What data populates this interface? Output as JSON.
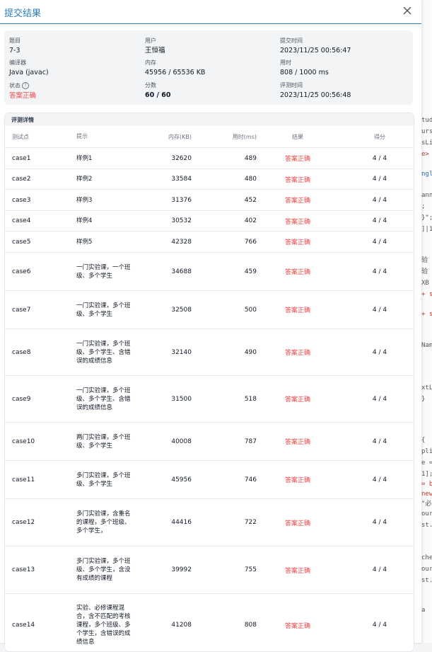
{
  "modal": {
    "title": "提交结果"
  },
  "info": {
    "problem_label": "题目",
    "problem_value": "7-3",
    "user_label": "用户",
    "user_value": "王恒福",
    "submit_time_label": "提交时间",
    "submit_time_value": "2023/11/25 00:56:47",
    "compiler_label": "编译器",
    "compiler_value": "Java (javac)",
    "memory_label": "内存",
    "memory_value": "45956 / 65536 KB",
    "time_label": "用时",
    "time_value": "808 / 1000 ms",
    "status_label": "状态",
    "status_help": "?",
    "status_value": "答案正确",
    "score_label": "分数",
    "score_value": "60 / 60",
    "judge_time_label": "评测时间",
    "judge_time_value": "2023/11/25 00:56:48"
  },
  "detail": {
    "title": "评测详情",
    "headers": {
      "case": "测试点",
      "hint": "提示",
      "memory": "内存(KB)",
      "time": "用时(ms)",
      "result": "结果",
      "score": "得分"
    },
    "rows": [
      {
        "case": "case1",
        "hint": "样例1",
        "memory": "32620",
        "time": "489",
        "result": "答案正确",
        "score": "4 / 4"
      },
      {
        "case": "case2",
        "hint": "样例2",
        "memory": "33584",
        "time": "480",
        "result": "答案正确",
        "score": "4 / 4"
      },
      {
        "case": "case3",
        "hint": "样例3",
        "memory": "31376",
        "time": "452",
        "result": "答案正确",
        "score": "4 / 4"
      },
      {
        "case": "case4",
        "hint": "样例4",
        "memory": "30532",
        "time": "402",
        "result": "答案正确",
        "score": "4 / 4"
      },
      {
        "case": "case5",
        "hint": "样例5",
        "memory": "42328",
        "time": "766",
        "result": "答案正确",
        "score": "4 / 4"
      },
      {
        "case": "case6",
        "hint": "一门实验课，一个班级、多个学生",
        "memory": "34688",
        "time": "459",
        "result": "答案正确",
        "score": "4 / 4"
      },
      {
        "case": "case7",
        "hint": "一门实验课，多个班级、多个学生",
        "memory": "32508",
        "time": "500",
        "result": "答案正确",
        "score": "4 / 4"
      },
      {
        "case": "case8",
        "hint": "一门实验课，多个班级、多个学生、含错误的成绩信息",
        "memory": "32140",
        "time": "490",
        "result": "答案正确",
        "score": "4 / 4"
      },
      {
        "case": "case9",
        "hint": "一门实验课，多个班级、多个学生、含错误的成绩信息",
        "memory": "31500",
        "time": "518",
        "result": "答案正确",
        "score": "4 / 4"
      },
      {
        "case": "case10",
        "hint": "两门实验课，多个班级、多个学生",
        "memory": "40008",
        "time": "787",
        "result": "答案正确",
        "score": "4 / 4"
      },
      {
        "case": "case11",
        "hint": "多门实验课，多个班级、多个学生",
        "memory": "45956",
        "time": "746",
        "result": "答案正确",
        "score": "4 / 4"
      },
      {
        "case": "case12",
        "hint": "多门实验课，含重名的课程，多个班级、多个学生，",
        "memory": "44416",
        "time": "722",
        "result": "答案正确",
        "score": "4 / 4"
      },
      {
        "case": "case13",
        "hint": "多门实验课，多个班级、多个学生，含没有成绩的课程",
        "memory": "39992",
        "time": "755",
        "result": "答案正确",
        "score": "4 / 4"
      },
      {
        "case": "case14",
        "hint": "实验、必修课程混合，含不匹配的考核课程，多个班级、多个学生，含错误的成绩信息",
        "memory": "41208",
        "time": "808",
        "result": "答案正确",
        "score": "4 / 4"
      }
    ]
  },
  "colors": {
    "accent": "#2b7ec2",
    "success_text": "#ef4444"
  }
}
